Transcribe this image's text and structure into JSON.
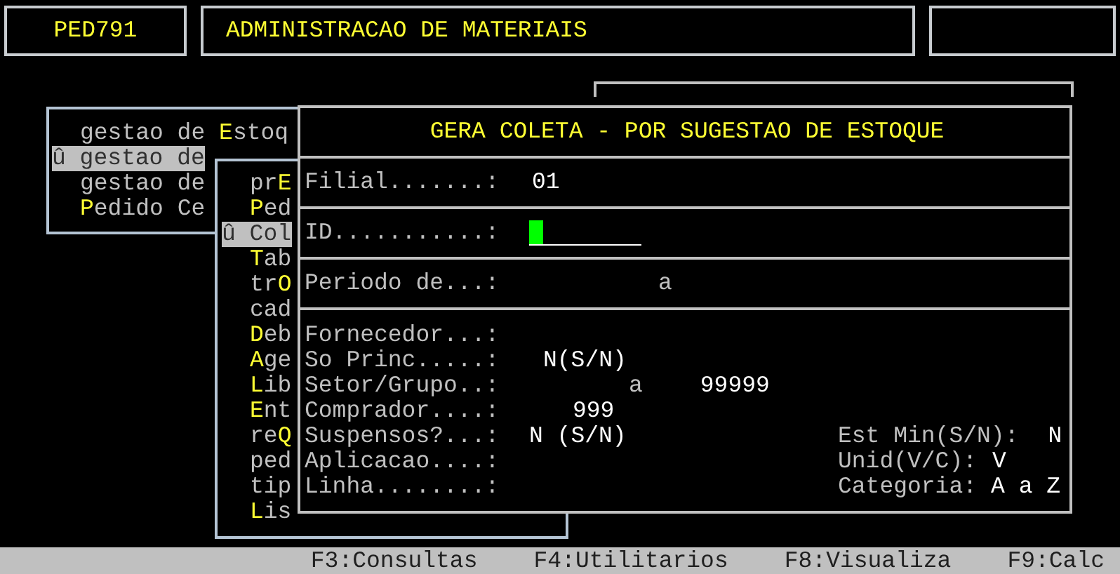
{
  "header": {
    "program": "PED791",
    "title": "ADMINISTRACAO DE MATERIAIS"
  },
  "menu": [
    {
      "text": "gestao de **E**stoq",
      "selected": false
    },
    {
      "text": "û gestao de",
      "selected": true
    },
    {
      "text": "gestao de",
      "selected": false
    },
    {
      "text": "**P**edido Ce",
      "selected": false
    }
  ],
  "submenu": [
    {
      "text": "pr**E**",
      "selected": false
    },
    {
      "text": "**P**ed",
      "selected": false
    },
    {
      "text": "û Col",
      "selected": true
    },
    {
      "text": "**T**ab",
      "selected": false
    },
    {
      "text": "tr**O**",
      "selected": false
    },
    {
      "text": "cad",
      "selected": false
    },
    {
      "text": "**D**eb",
      "selected": false
    },
    {
      "text": "**A**ge",
      "selected": false
    },
    {
      "text": "**L**ib",
      "selected": false
    },
    {
      "text": "**E**nt",
      "selected": false
    },
    {
      "text": "re**Q**",
      "selected": false
    },
    {
      "text": "ped",
      "selected": false
    },
    {
      "text": "tip",
      "selected": false
    },
    {
      "text": "**L**is",
      "selected": false
    }
  ],
  "dialog": {
    "title": "GERA COLETA - POR SUGESTAO DE ESTOQUE",
    "sections": [
      {
        "label": "Filial.......:",
        "values": [
          {
            "text": "01",
            "kind": "value"
          }
        ]
      },
      {
        "label": "ID...........:",
        "kind": "input"
      },
      {
        "label": "Periodo de...:",
        "values": [
          {
            "text": "a",
            "kind": "sep"
          }
        ]
      }
    ],
    "filters": [
      {
        "label": "Fornecedor...:"
      },
      {
        "label": "So Princ.....:",
        "values": [
          {
            "text": "N(S/N)",
            "kind": "value"
          }
        ]
      },
      {
        "label": "Setor/Grupo..:",
        "values": [
          {
            "text": "a",
            "kind": "sep"
          },
          {
            "text": "99999",
            "kind": "value"
          }
        ]
      },
      {
        "label": "Comprador....:",
        "values": [
          {
            "text": "999",
            "kind": "value"
          }
        ]
      },
      {
        "label": "Suspensos?...:",
        "values": [
          {
            "text": "N (S/N)",
            "kind": "value"
          }
        ],
        "option": {
          "label": "Est Min(S/N):",
          "value": "N"
        }
      },
      {
        "label": "Aplicacao....:",
        "option": {
          "label": "Unid(V/C):",
          "value": "V"
        }
      },
      {
        "label": "Linha........:",
        "option": {
          "label": "Categoria:",
          "value": "A a Z"
        }
      }
    ]
  },
  "status_bar": [
    "F3:Consultas",
    "F4:Utilitarios",
    "F8:Visualiza",
    "F9:Calc"
  ]
}
